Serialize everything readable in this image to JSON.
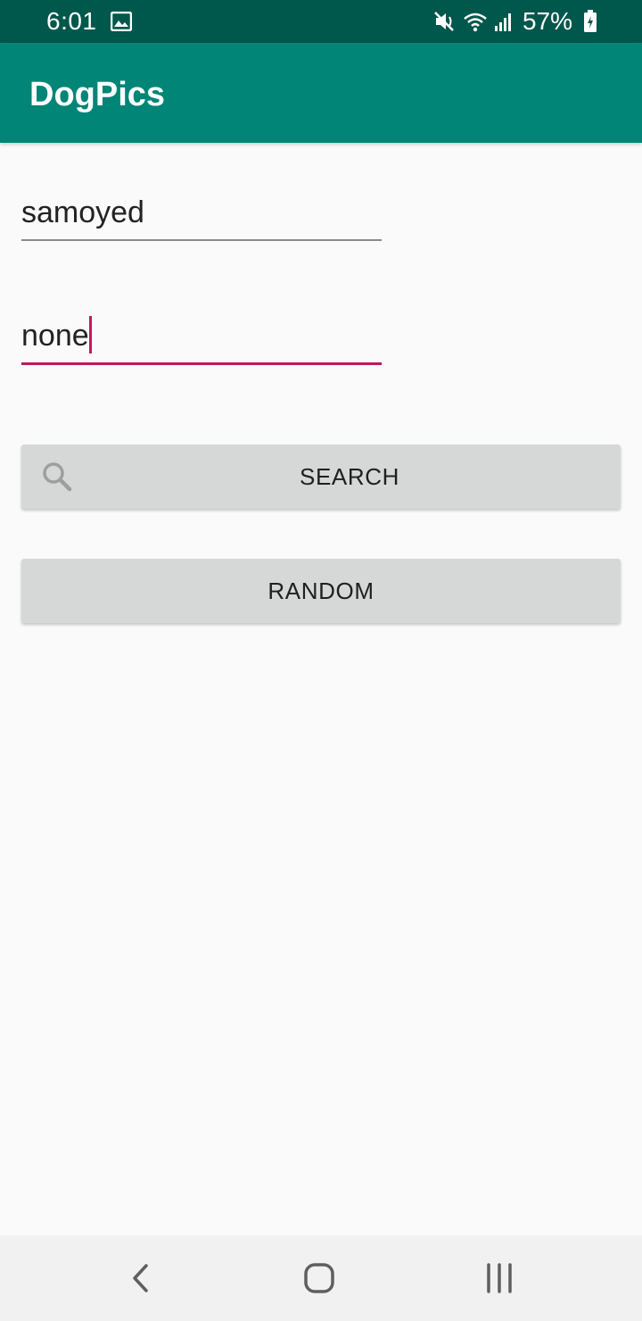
{
  "status_bar": {
    "time": "6:01",
    "battery_percent": "57%",
    "icons": [
      "gallery-icon",
      "mute-icon",
      "wifi-icon",
      "signal-icon",
      "battery-icon"
    ]
  },
  "app_bar": {
    "title": "DogPics"
  },
  "form": {
    "breed_value": "samoyed",
    "sub_breed_value": "none"
  },
  "buttons": {
    "search_label": "SEARCH",
    "random_label": "RANDOM"
  },
  "nav_bar": {
    "icons": [
      "back-icon",
      "home-icon",
      "recents-icon"
    ]
  },
  "colors": {
    "status_bar": "#00574b",
    "app_bar": "#008577",
    "accent": "#c2185b",
    "button_bg": "#d6d7d7"
  }
}
